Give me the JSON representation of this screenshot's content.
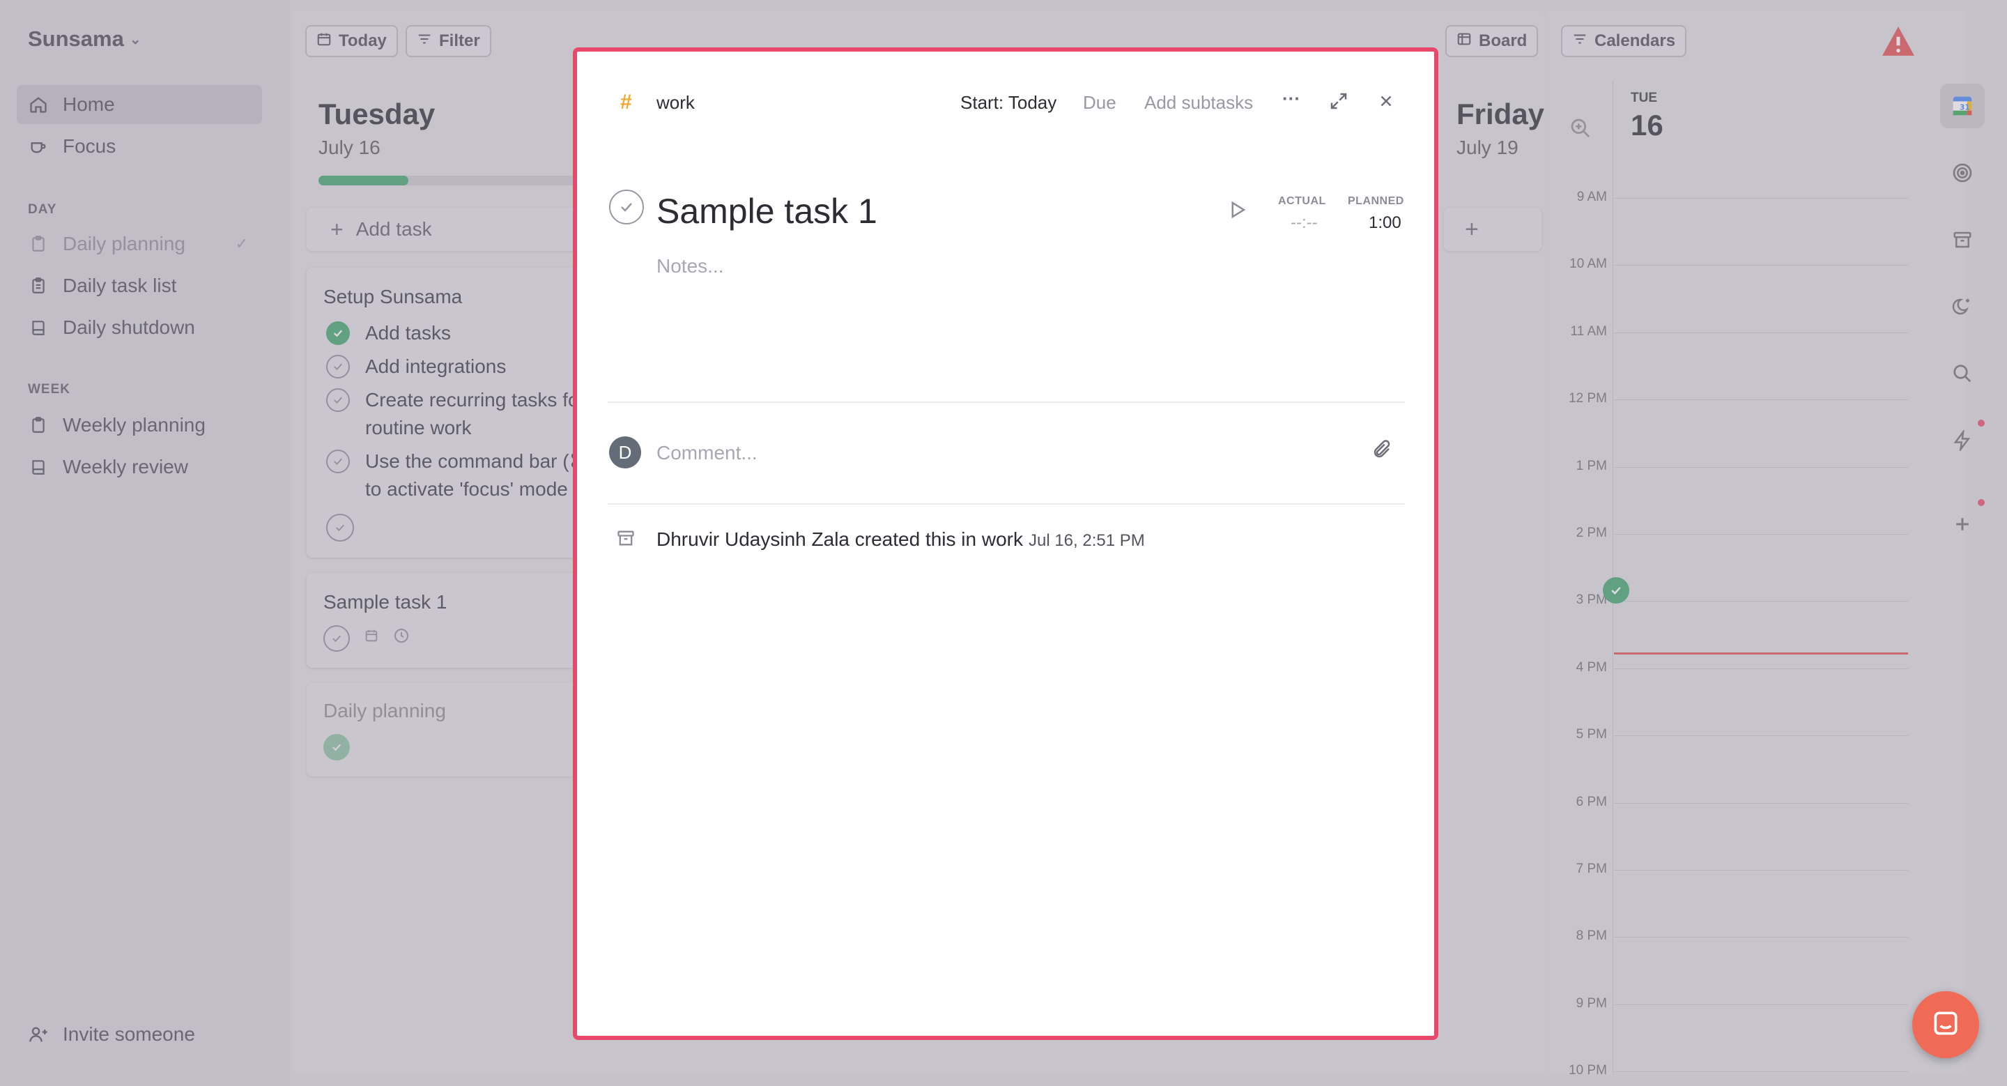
{
  "sidebar": {
    "brand": "Sunsama",
    "nav": [
      {
        "label": "Home"
      },
      {
        "label": "Focus"
      }
    ],
    "day_section": "DAY",
    "day_items": [
      {
        "label": "Daily planning"
      },
      {
        "label": "Daily task list"
      },
      {
        "label": "Daily shutdown"
      }
    ],
    "week_section": "WEEK",
    "week_items": [
      {
        "label": "Weekly planning"
      },
      {
        "label": "Weekly review"
      }
    ],
    "invite": "Invite someone"
  },
  "toolbar": {
    "today": "Today",
    "filter": "Filter",
    "board": "Board",
    "calendars": "Calendars"
  },
  "tuesday": {
    "day": "Tuesday",
    "date": "July 16",
    "progress": 0.23,
    "add_task": "Add task",
    "setup_card": {
      "title": "Setup Sunsama",
      "items": [
        {
          "text": "Add tasks",
          "done": true
        },
        {
          "text": "Add integrations",
          "done": false
        },
        {
          "text": "Create recurring tasks fo",
          "text2": "routine work",
          "done": false
        },
        {
          "text": "Use the command bar (⌘",
          "text2": "to activate 'focus' mode",
          "done": false
        }
      ]
    },
    "sample_card": {
      "title": "Sample task 1"
    },
    "planning_card": {
      "title": "Daily planning"
    }
  },
  "friday": {
    "day": "Friday",
    "date": "July 19",
    "add": "+"
  },
  "calendar": {
    "day_abbr": "TUE",
    "day_num": "16",
    "hours": [
      "9 AM",
      "10 AM",
      "11 AM",
      "12 PM",
      "1 PM",
      "2 PM",
      "3 PM",
      "4 PM",
      "5 PM",
      "6 PM",
      "7 PM",
      "8 PM",
      "9 PM",
      "10 PM"
    ]
  },
  "modal": {
    "hash": "#",
    "project": "work",
    "start": "Start: Today",
    "due": "Due",
    "add_subtasks": "Add subtasks",
    "more": "···",
    "title": "Sample task 1",
    "notes_placeholder": "Notes...",
    "actual_label": "ACTUAL",
    "actual_value": "--:--",
    "planned_label": "PLANNED",
    "planned_value": "1:00",
    "avatar_letter": "D",
    "comment_placeholder": "Comment...",
    "activity_text": "Dhruvir Udaysinh Zala created this in work",
    "activity_time": "Jul 16, 2:51 PM"
  },
  "colors": {
    "accent_green": "#3fa56c",
    "modal_border": "#e8496b",
    "hash_orange": "#f2a62d",
    "now_line": "#e0504f",
    "chat": "#f06a56"
  }
}
